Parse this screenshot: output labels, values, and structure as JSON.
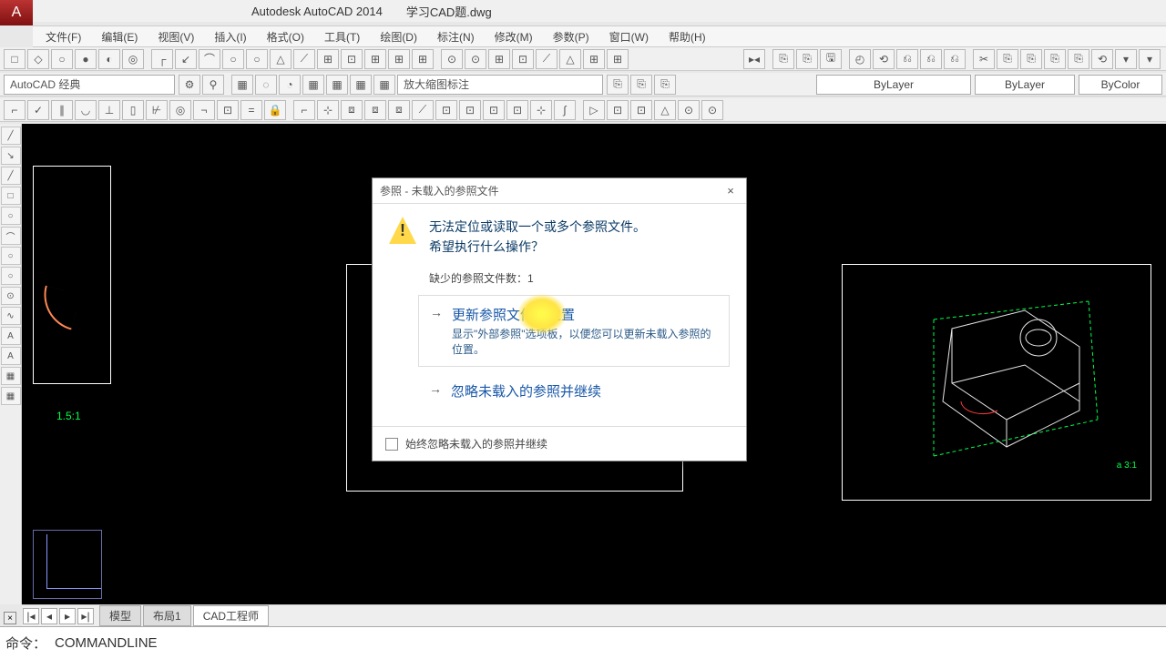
{
  "app": {
    "logo_letter": "A",
    "name": "Autodesk AutoCAD 2014",
    "filename": "学习CAD题.dwg"
  },
  "menu": [
    "文件(F)",
    "编辑(E)",
    "视图(V)",
    "插入(I)",
    "格式(O)",
    "工具(T)",
    "绘图(D)",
    "标注(N)",
    "修改(M)",
    "参数(P)",
    "窗口(W)",
    "帮助(H)"
  ],
  "toolbar1_icons": [
    "□",
    "◇",
    "○",
    "●",
    "◐",
    "◎",
    "｜",
    "┌",
    "↙",
    "⌒",
    "○",
    "○",
    "△",
    "⟋",
    "⊞",
    "⊡",
    "⊞",
    "⊞",
    "⊞",
    "｜",
    "⊙",
    "⊙",
    "⊞",
    "⊡",
    "⟋",
    "△",
    "⊞",
    "⊞"
  ],
  "toolbar1_right": [
    "▸◂",
    "｜",
    "⎘",
    "⎘",
    "🖫",
    "｜",
    "◴",
    "⟲",
    "⎌",
    "⎌",
    "⎌",
    "｜",
    "✂",
    "⎘",
    "⎘",
    "⎘",
    "⎘",
    "⟲",
    "▾",
    "▾"
  ],
  "row2": {
    "layer_field": "AutoCAD 经典",
    "search_icon": "⚙",
    "filter_icon": "⚲",
    "layer_palette_icons": [
      "▦",
      "◌",
      "◔",
      "▦",
      "▦",
      "▦",
      "▦"
    ],
    "annotation_label": "放大缩图标注",
    "xref_icons": [
      "⎘",
      "⎘",
      "⎘"
    ],
    "prop1": "ByLayer",
    "prop2": "ByLayer",
    "prop3": "ByColor"
  },
  "row3_icons_a": [
    "⌐",
    "✓",
    "∥",
    "◡",
    "⊥",
    "▯",
    "⊬",
    "◎",
    "¬",
    "⊡",
    "=",
    "🔒"
  ],
  "row3_icons_b": [
    "⌐",
    "⊹",
    "⧈",
    "⧈",
    "⧈",
    "⟋",
    "⊡",
    "⊡",
    "⊡",
    "⊡",
    "⊹",
    "∫"
  ],
  "row3_icons_c": [
    "▷",
    "⊡",
    "⊡",
    "△",
    "⊙",
    "⊙"
  ],
  "left_tools": [
    "╱",
    "↘",
    "╱",
    "□",
    "○",
    "⌒",
    "○",
    "○",
    "⊙",
    "∿",
    "A",
    "A",
    "▦",
    "▦"
  ],
  "canvas": {
    "label1": "1.5:1",
    "label2": "a 3:1"
  },
  "tabs": {
    "nav": [
      "|◂",
      "◂",
      "▸",
      "▸|"
    ],
    "items": [
      "模型",
      "布局1",
      "CAD工程师"
    ],
    "active": 2
  },
  "command": {
    "prompt": "命令：",
    "text": "COMMANDLINE"
  },
  "close_x": "×",
  "dialog": {
    "title": "参照 - 未载入的参照文件",
    "close": "×",
    "msg_line1": "无法定位或读取一个或多个参照文件。",
    "msg_line2": "希望执行什么操作？",
    "count_label": "缺少的参照文件数：1",
    "option1_title": "更新参照文件的位置",
    "option1_desc": "显示\"外部参照\"选项板，以便您可以更新未载入参照的位置。",
    "option2_title": "忽略未载入的参照并继续",
    "foot_checkbox": "始终忽略未载入的参照并继续"
  }
}
